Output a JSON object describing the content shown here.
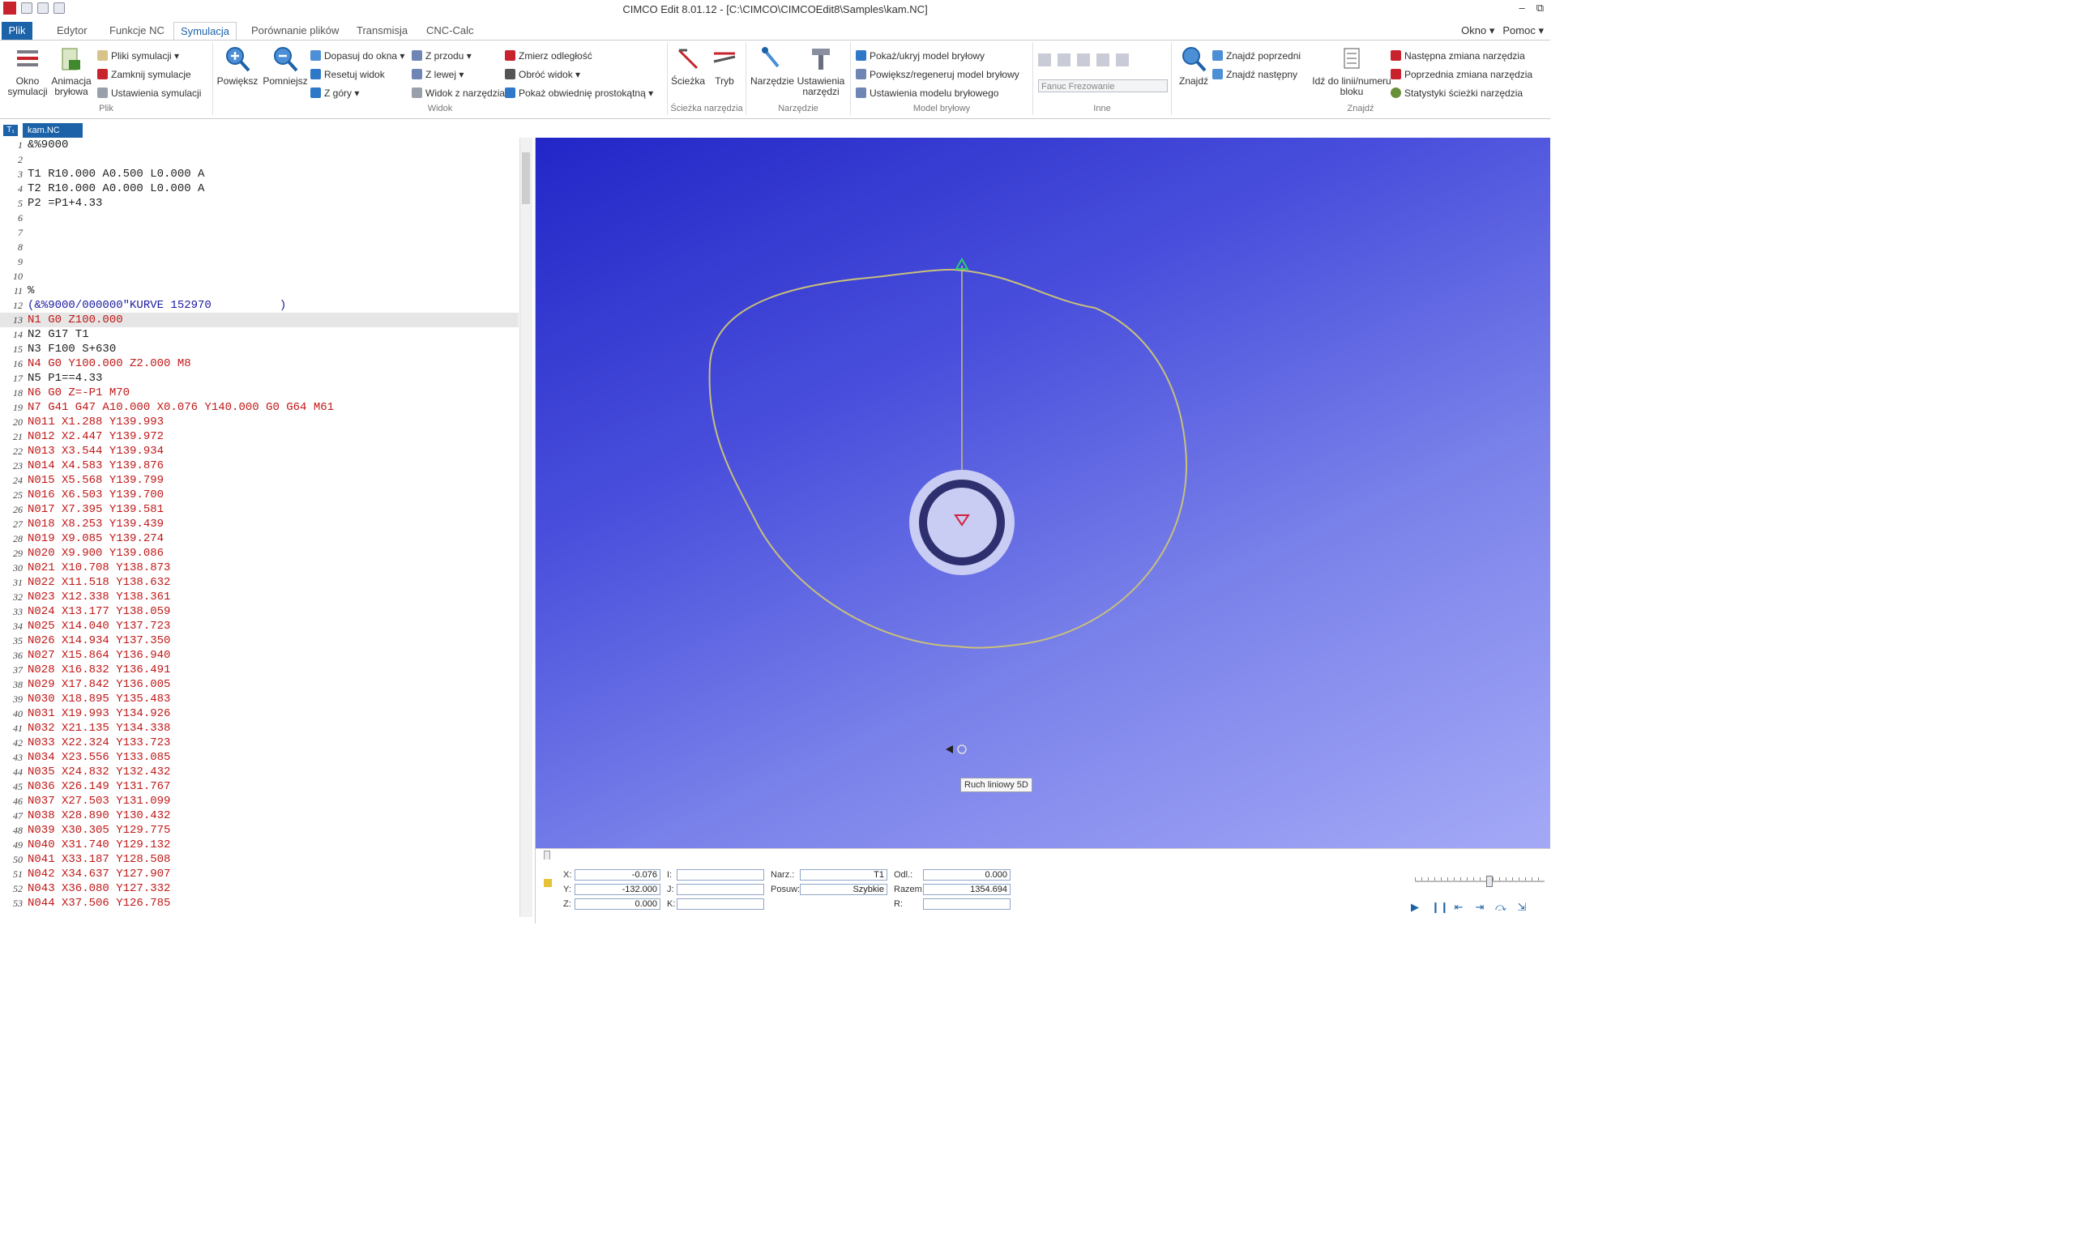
{
  "title": "CIMCO Edit 8.01.12 - [C:\\CIMCO\\CIMCOEdit8\\Samples\\kam.NC]",
  "window_buttons": [
    "–",
    "⧉",
    "–",
    "×"
  ],
  "tabs": [
    {
      "label": "Plik"
    },
    {
      "label": "Edytor"
    },
    {
      "label": "Funkcje NC"
    },
    {
      "label": "Symulacja"
    },
    {
      "label": "Porównanie plików"
    },
    {
      "label": "Transmisja"
    },
    {
      "label": "CNC-Calc"
    }
  ],
  "tabs_right": {
    "okno": "Okno ▾",
    "pomoc": "Pomoc ▾"
  },
  "ribbon": {
    "plik": {
      "label": "Plik",
      "okno": "Okno symulacji",
      "animacja": "Animacja bryłowa",
      "pliki": "Pliki symulacji ▾",
      "zamknij": "Zamknij symulacje",
      "ustawienia": "Ustawienia symulacji"
    },
    "widok": {
      "label": "Widok",
      "powieksz": "Powiększ",
      "pomniejsz": "Pomniejsz",
      "dopasuj": "Dopasuj do okna ▾",
      "resetuj": "Resetuj widok",
      "zgory": "Z góry ▾",
      "zprzodu": "Z przodu ▾",
      "zlewej": "Z lewej ▾",
      "widokz": "Widok z narzędzia",
      "zmierz": "Zmierz odległość",
      "obroc": "Obróć widok ▾",
      "pokaz": "Pokaż obwiednię prostokątną ▾"
    },
    "sciezka": {
      "label": "Ścieżka narzędzia",
      "sciezka": "Ścieżka",
      "tryb": "Tryb"
    },
    "narzedzie": {
      "label": "Narzędzie",
      "narzedzia": "Narzędzie",
      "ustawienia": "Ustawienia narzędzi"
    },
    "model": {
      "label": "Model bryłowy",
      "pokaz": "Pokaż/ukryj model bryłowy",
      "powieksz": "Powiększ/regeneruj model bryłowy",
      "ustawienia": "Ustawienia modelu bryłowego"
    },
    "inne": {
      "label": "Inne",
      "combo": "Fanuc Frezowanie"
    },
    "znajdz": {
      "label": "Znajdź",
      "znajdz": "Znajdź",
      "poprzedni": "Znajdź poprzedni",
      "nastepny": "Znajdź następny",
      "idz": "Idź do linii/numeru bloku",
      "nastepna_zmiana": "Następna zmiana narzędzia",
      "poprzednia_zmiana": "Poprzednia zmiana narzędzia",
      "statystyki": "Statystyki ścieżki narzędzia"
    }
  },
  "doc_tab": {
    "corner": "T₁",
    "name": "kam.NC"
  },
  "code": [
    {
      "n": "1",
      "t": "&%9000",
      "c": "#222222"
    },
    {
      "n": "2",
      "t": "",
      "c": "#222222"
    },
    {
      "n": "3",
      "t": "T1 R10.000 A0.500 L0.000 A",
      "c": "#222222"
    },
    {
      "n": "4",
      "t": "T2 R10.000 A0.000 L0.000 A",
      "c": "#222222"
    },
    {
      "n": "5",
      "t": "P2 =P1+4.33",
      "c": "#222222"
    },
    {
      "n": "6",
      "t": "",
      "c": "#222222"
    },
    {
      "n": "7",
      "t": "",
      "c": "#222222"
    },
    {
      "n": "8",
      "t": "",
      "c": "#222222"
    },
    {
      "n": "9",
      "t": "",
      "c": "#222222"
    },
    {
      "n": "10",
      "t": "",
      "c": "#222222"
    },
    {
      "n": "11",
      "t": "%",
      "c": "#222222"
    },
    {
      "n": "12",
      "t": "(&%9000/000000\"KURVE 152970          )",
      "c": "#1a1aa0"
    },
    {
      "n": "13",
      "t": "N1 G0 Z100.000",
      "c": "#c01818"
    },
    {
      "n": "14",
      "t": "N2 G17 T1",
      "c": "#222222"
    },
    {
      "n": "15",
      "t": "N3 F100 S+630",
      "c": "#222222"
    },
    {
      "n": "16",
      "t": "N4 G0 Y100.000 Z2.000 M8",
      "c": "#c01818"
    },
    {
      "n": "17",
      "t": "N5 P1==4.33",
      "c": "#222222"
    },
    {
      "n": "18",
      "t": "N6 G0 Z=-P1 M70",
      "c": "#c01818"
    },
    {
      "n": "19",
      "t": "N7 G41 G47 A10.000 X0.076 Y140.000 G0 G64 M61",
      "c": "#c01818"
    },
    {
      "n": "20",
      "t": "N011 X1.288 Y139.993",
      "c": "#c01818"
    },
    {
      "n": "21",
      "t": "N012 X2.447 Y139.972",
      "c": "#c01818"
    },
    {
      "n": "22",
      "t": "N013 X3.544 Y139.934",
      "c": "#c01818"
    },
    {
      "n": "23",
      "t": "N014 X4.583 Y139.876",
      "c": "#c01818"
    },
    {
      "n": "24",
      "t": "N015 X5.568 Y139.799",
      "c": "#c01818"
    },
    {
      "n": "25",
      "t": "N016 X6.503 Y139.700",
      "c": "#c01818"
    },
    {
      "n": "26",
      "t": "N017 X7.395 Y139.581",
      "c": "#c01818"
    },
    {
      "n": "27",
      "t": "N018 X8.253 Y139.439",
      "c": "#c01818"
    },
    {
      "n": "28",
      "t": "N019 X9.085 Y139.274",
      "c": "#c01818"
    },
    {
      "n": "29",
      "t": "N020 X9.900 Y139.086",
      "c": "#c01818"
    },
    {
      "n": "30",
      "t": "N021 X10.708 Y138.873",
      "c": "#c01818"
    },
    {
      "n": "31",
      "t": "N022 X11.518 Y138.632",
      "c": "#c01818"
    },
    {
      "n": "32",
      "t": "N023 X12.338 Y138.361",
      "c": "#c01818"
    },
    {
      "n": "33",
      "t": "N024 X13.177 Y138.059",
      "c": "#c01818"
    },
    {
      "n": "34",
      "t": "N025 X14.040 Y137.723",
      "c": "#c01818"
    },
    {
      "n": "35",
      "t": "N026 X14.934 Y137.350",
      "c": "#c01818"
    },
    {
      "n": "36",
      "t": "N027 X15.864 Y136.940",
      "c": "#c01818"
    },
    {
      "n": "37",
      "t": "N028 X16.832 Y136.491",
      "c": "#c01818"
    },
    {
      "n": "38",
      "t": "N029 X17.842 Y136.005",
      "c": "#c01818"
    },
    {
      "n": "39",
      "t": "N030 X18.895 Y135.483",
      "c": "#c01818"
    },
    {
      "n": "40",
      "t": "N031 X19.993 Y134.926",
      "c": "#c01818"
    },
    {
      "n": "41",
      "t": "N032 X21.135 Y134.338",
      "c": "#c01818"
    },
    {
      "n": "42",
      "t": "N033 X22.324 Y133.723",
      "c": "#c01818"
    },
    {
      "n": "43",
      "t": "N034 X23.556 Y133.085",
      "c": "#c01818"
    },
    {
      "n": "44",
      "t": "N035 X24.832 Y132.432",
      "c": "#c01818"
    },
    {
      "n": "45",
      "t": "N036 X26.149 Y131.767",
      "c": "#c01818"
    },
    {
      "n": "46",
      "t": "N037 X27.503 Y131.099",
      "c": "#c01818"
    },
    {
      "n": "47",
      "t": "N038 X28.890 Y130.432",
      "c": "#c01818"
    },
    {
      "n": "48",
      "t": "N039 X30.305 Y129.775",
      "c": "#c01818"
    },
    {
      "n": "49",
      "t": "N040 X31.740 Y129.132",
      "c": "#c01818"
    },
    {
      "n": "50",
      "t": "N041 X33.187 Y128.508",
      "c": "#c01818"
    },
    {
      "n": "51",
      "t": "N042 X34.637 Y127.907",
      "c": "#c01818"
    },
    {
      "n": "52",
      "t": "N043 X36.080 Y127.332",
      "c": "#c01818"
    },
    {
      "n": "53",
      "t": "N044 X37.506 Y126.785",
      "c": "#c01818"
    }
  ],
  "highlight_line": "13",
  "tooltip": "Ruch liniowy 5D",
  "info": {
    "x_label": "X:",
    "x": "-0.076",
    "y_label": "Y:",
    "y": "-132.000",
    "z_label": "Z:",
    "z": "0.000",
    "i_label": "I:",
    "i": "",
    "j_label": "J:",
    "j": "",
    "k_label": "K:",
    "k": "",
    "narz_label": "Narz.:",
    "narz": "T1",
    "posuw_label": "Posuw:",
    "posuw": "Szybkie",
    "odl_label": "Odl.:",
    "odl": "0.000",
    "razem_label": "Razem:",
    "razem": "1354.694",
    "r_label": "R:",
    "r": ""
  },
  "colors": {
    "accent": "#1c62a8",
    "code_red": "#c01818",
    "code_black": "#222222",
    "code_blue": "#1a1aa0",
    "path": "#c9c07a",
    "tool_ring": "#2e2f6e",
    "tool_disc": "#c9ccf3"
  },
  "icons": {
    "sim_window": "sim-window-icon",
    "zoom_in": "magnifier-plus-icon",
    "zoom_out": "magnifier-minus-icon",
    "find": "magnifier-icon",
    "play": "play-icon",
    "pause": "pause-icon"
  }
}
